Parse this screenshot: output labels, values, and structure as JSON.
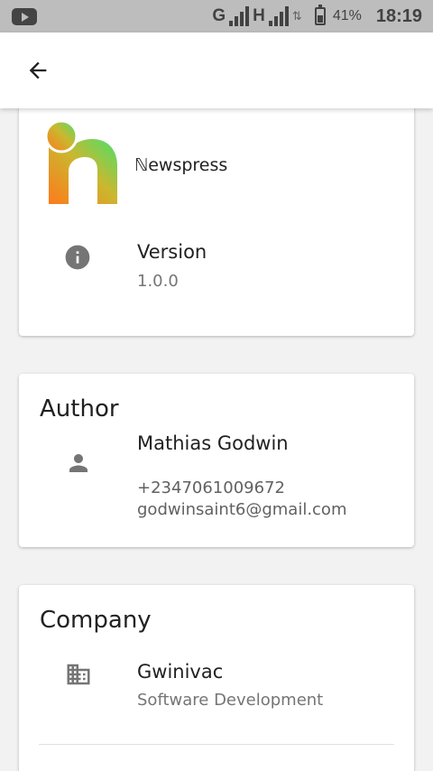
{
  "status_bar": {
    "network_letter_1": "G",
    "network_letter_2": "H",
    "battery": "41%",
    "time": "18:19"
  },
  "app_bar": {
    "back_icon": "arrow-back-icon"
  },
  "app_card": {
    "logo_letter": "n",
    "app_name": "ℕewspress",
    "version_icon": "info-icon",
    "version_label": "Version",
    "version_value": "1.0.0"
  },
  "author": {
    "title": "Author",
    "icon": "person-icon",
    "name": "Mathias Godwin",
    "phone": "+2347061009672",
    "email": "godwinsaint6@gmail.com"
  },
  "company": {
    "title": "Company",
    "icon": "business-icon",
    "name": "Gwinivac",
    "description": "Software Development"
  }
}
